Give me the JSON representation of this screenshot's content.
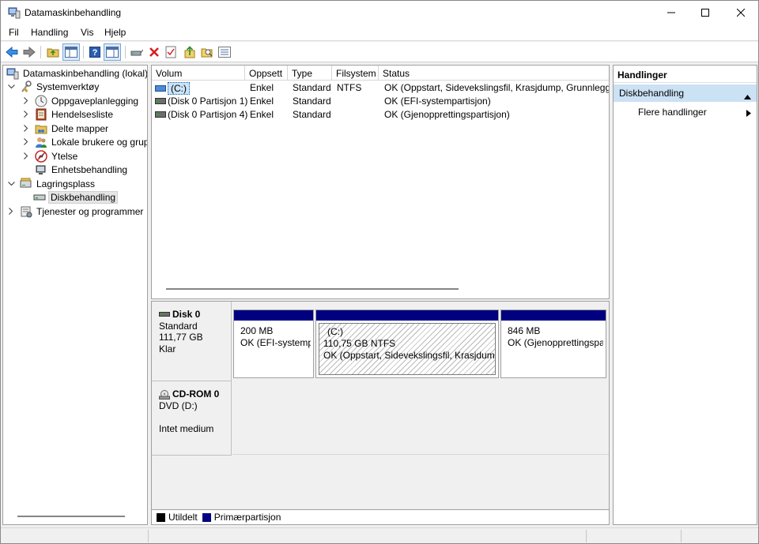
{
  "window": {
    "title": "Datamaskinbehandling"
  },
  "menu": [
    "Fil",
    "Handling",
    "Vis",
    "Hjelp"
  ],
  "tree": {
    "root": "Datamaskinbehandling (lokal)",
    "system_tools": "Systemverktøy",
    "task_scheduler": "Oppgaveplanlegging",
    "event_viewer": "Hendelsesliste",
    "shared_folders": "Delte mapper",
    "local_users": "Lokale brukere og grupper",
    "performance": "Ytelse",
    "device_manager": "Enhetsbehandling",
    "storage": "Lagringsplass",
    "disk_management": "Diskbehandling",
    "services_apps": "Tjenester og programmer"
  },
  "columns": [
    "Volum",
    "Oppsett",
    "Type",
    "Filsystem",
    "Status"
  ],
  "volumes": [
    {
      "name": "(C:)",
      "layout": "Enkel",
      "type": "Standard",
      "fs": "NTFS",
      "status": "OK (Oppstart, Sidevekslingsfil, Krasjdump, Grunnleggende datapartisjon)"
    },
    {
      "name": "(Disk 0 Partisjon 1)",
      "layout": "Enkel",
      "type": "Standard",
      "fs": "",
      "status": "OK (EFI-systempartisjon)"
    },
    {
      "name": "(Disk 0 Partisjon 4)",
      "layout": "Enkel",
      "type": "Standard",
      "fs": "",
      "status": "OK (Gjenopprettingspartisjon)"
    }
  ],
  "disks": [
    {
      "name": "Disk 0",
      "kind": "Standard",
      "size": "111,77 GB",
      "state": "Klar"
    },
    {
      "name": "CD-ROM 0",
      "kind": "DVD (D:)",
      "size": "",
      "state": "Intet medium"
    }
  ],
  "partitions": [
    {
      "label": "",
      "size": "200 MB",
      "status": "OK (EFI-systempartisjon)"
    },
    {
      "label": "(C:)",
      "size": "110,75 GB NTFS",
      "status": "OK (Oppstart, Sidevekslingsfil, Krasjdump, Grunnleggende datapartisjon)"
    },
    {
      "label": "",
      "size": "846 MB",
      "status": "OK (Gjenopprettingspartisjon)"
    }
  ],
  "legend": {
    "unallocated": "Utildelt",
    "primary": "Primærpartisjon"
  },
  "colors": {
    "primary_partition": "#000080",
    "unallocated": "#000000",
    "action_section": "#cbe1f4",
    "selection": "#cce4f7"
  },
  "actions": {
    "header": "Handlinger",
    "section": "Diskbehandling",
    "more": "Flere handlinger"
  }
}
